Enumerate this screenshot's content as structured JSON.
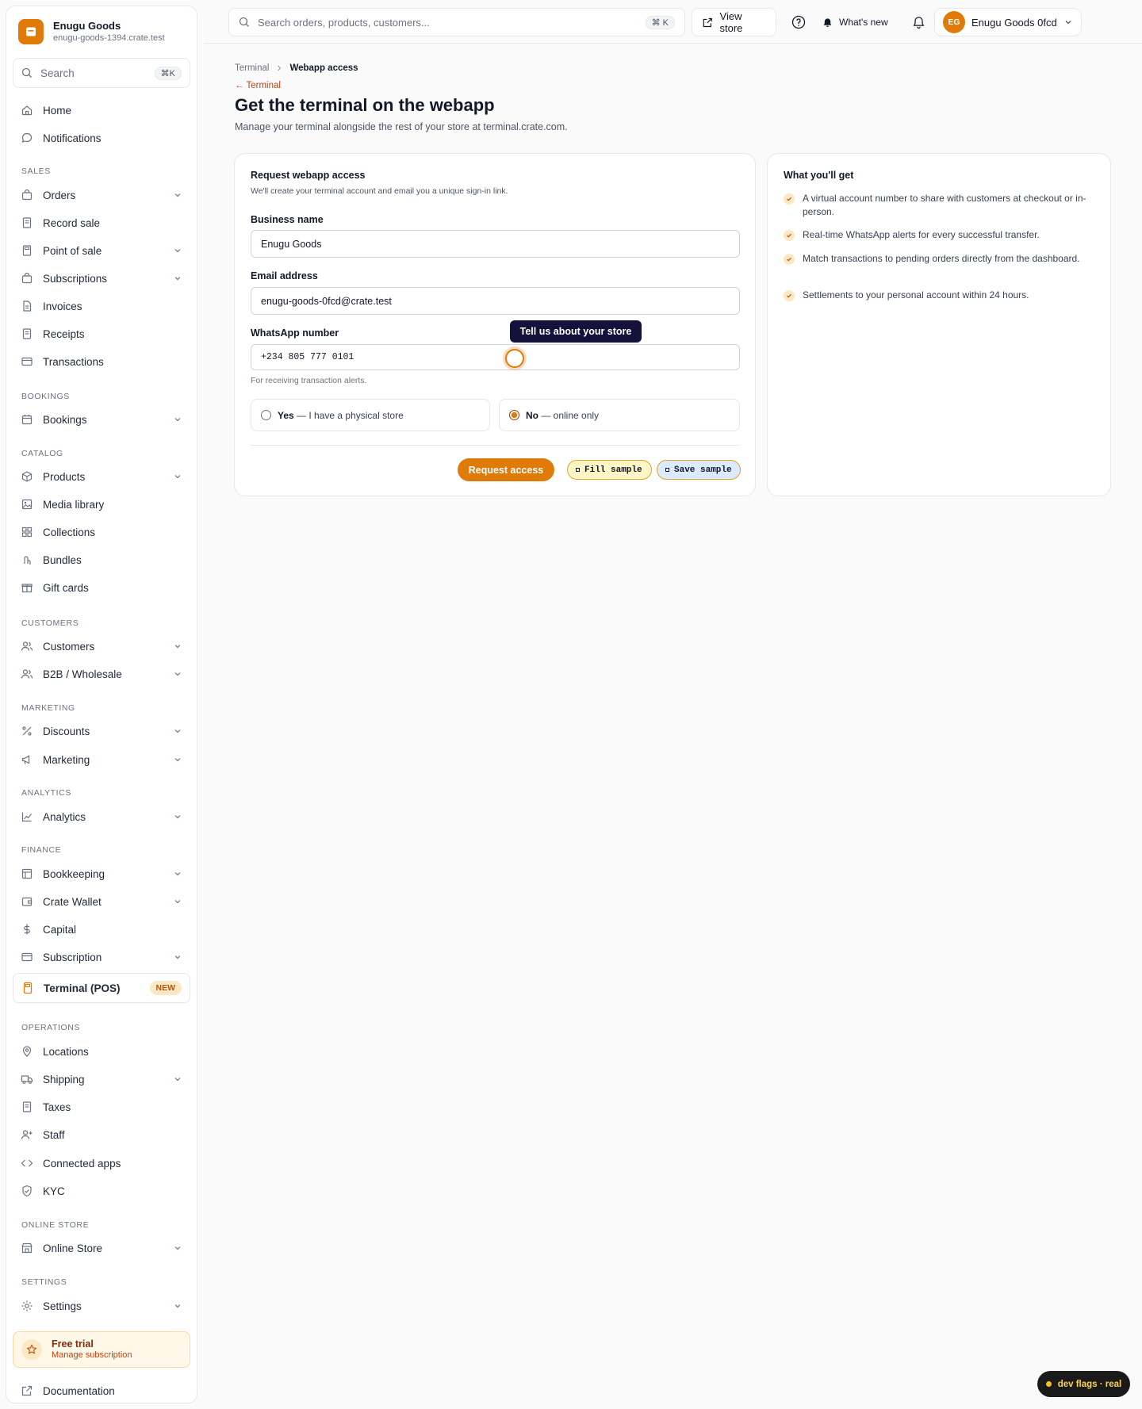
{
  "brand": {
    "name": "Enugu Goods",
    "url": "enugu-goods-1394.crate.test"
  },
  "sidebar_search": {
    "label": "Search",
    "shortcut": "⌘K"
  },
  "nav": {
    "home": "Home",
    "notifications": "Notifications",
    "sales_label": "SALES",
    "orders": "Orders",
    "record_sale": "Record sale",
    "point_of_sale": "Point of sale",
    "subscriptions": "Subscriptions",
    "invoices": "Invoices",
    "receipts": "Receipts",
    "transactions": "Transactions",
    "bookings_label": "BOOKINGS",
    "bookings": "Bookings",
    "catalog_label": "CATALOG",
    "products": "Products",
    "media_library": "Media library",
    "collections": "Collections",
    "bundles": "Bundles",
    "gift_cards": "Gift cards",
    "customers_label": "CUSTOMERS",
    "customers": "Customers",
    "b2b": "B2B / Wholesale",
    "marketing_label": "MARKETING",
    "discounts": "Discounts",
    "marketing": "Marketing",
    "analytics_label": "ANALYTICS",
    "analytics": "Analytics",
    "finance_label": "FINANCE",
    "bookkeeping": "Bookkeeping",
    "crate_wallet": "Crate Wallet",
    "capital": "Capital",
    "subscription": "Subscription",
    "terminal": "Terminal (POS)",
    "terminal_badge": "NEW",
    "operations_label": "OPERATIONS",
    "locations": "Locations",
    "shipping": "Shipping",
    "taxes": "Taxes",
    "staff": "Staff",
    "connected_apps": "Connected apps",
    "kyc": "KYC",
    "online_store_label": "ONLINE STORE",
    "online_store": "Online Store",
    "settings_label": "SETTINGS",
    "settings": "Settings"
  },
  "trial": {
    "title": "Free trial",
    "subtitle": "Manage subscription"
  },
  "documentation": "Documentation",
  "topbar": {
    "search_placeholder": "Search orders, products, customers...",
    "search_shortcut": "⌘ K",
    "view_store": "View store",
    "whats_new": "What's new",
    "account_initials": "EG",
    "account_name": "Enugu Goods 0fcd"
  },
  "breadcrumb": {
    "parent": "Terminal",
    "current": "Webapp access"
  },
  "back_link": "← Terminal",
  "page": {
    "title": "Get the terminal on the webapp",
    "subtitle": "Manage your terminal alongside the rest of your store at terminal.crate.com."
  },
  "form": {
    "title": "Request webapp access",
    "subtitle": "We'll create your terminal account and email you a unique sign-in link.",
    "business_label": "Business name",
    "business_value": "Enugu Goods",
    "email_label": "Email address",
    "email_value": "enugu-goods-0fcd@crate.test",
    "whatsapp_label": "WhatsApp number",
    "whatsapp_value": "+234 805 777 0101",
    "whatsapp_hint": "For receiving transaction alerts.",
    "yes_strong": "Yes",
    "yes_rest": " — I have a physical store",
    "no_strong": "No",
    "no_rest": " — online only",
    "submit": "Request access",
    "fill_sample": "Fill sample",
    "save_sample": "Save sample"
  },
  "tooltip": "Tell us about your store",
  "benefits": {
    "title": "What you'll get",
    "items": [
      "A virtual account number to share with customers at checkout or in-person.",
      "Real-time WhatsApp alerts for every successful transfer.",
      "Match transactions to pending orders directly from the dashboard.",
      "Settlements to your personal account within 24 hours."
    ]
  },
  "dev_flags": "dev flags · real",
  "colors": {
    "accent": "#e07b0a",
    "tooltip_bg": "#14123a"
  }
}
